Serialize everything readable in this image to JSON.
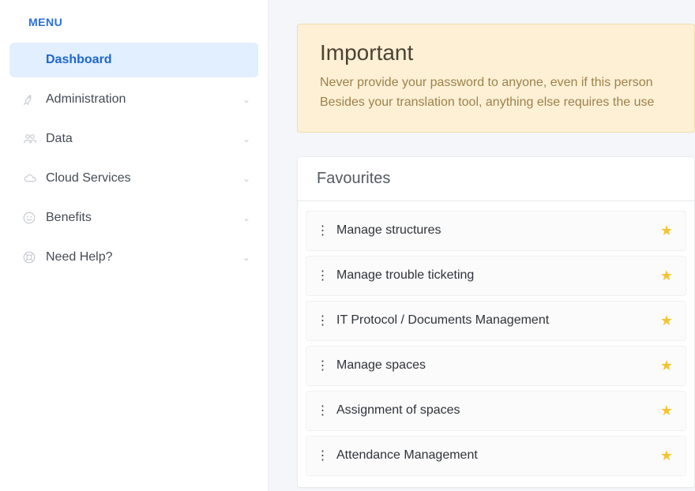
{
  "sidebar": {
    "title": "MENU",
    "items": [
      {
        "label": "Dashboard",
        "icon": "",
        "active": true,
        "expandable": false
      },
      {
        "label": "Administration",
        "icon": "rocket",
        "active": false,
        "expandable": true
      },
      {
        "label": "Data",
        "icon": "users",
        "active": false,
        "expandable": true
      },
      {
        "label": "Cloud Services",
        "icon": "cloud",
        "active": false,
        "expandable": true
      },
      {
        "label": "Benefits",
        "icon": "smile",
        "active": false,
        "expandable": true
      },
      {
        "label": "Need Help?",
        "icon": "life-ring",
        "active": false,
        "expandable": true
      }
    ]
  },
  "alert": {
    "title": "Important",
    "line1": "Never provide your password to anyone, even if this person ",
    "line2": "Besides your translation tool, anything else requires the use "
  },
  "favourites": {
    "title": "Favourites",
    "items": [
      {
        "label": "Manage structures"
      },
      {
        "label": "Manage trouble ticketing"
      },
      {
        "label": "IT Protocol / Documents Management"
      },
      {
        "label": "Manage spaces"
      },
      {
        "label": "Assignment of spaces"
      },
      {
        "label": "Attendance Management"
      }
    ]
  }
}
